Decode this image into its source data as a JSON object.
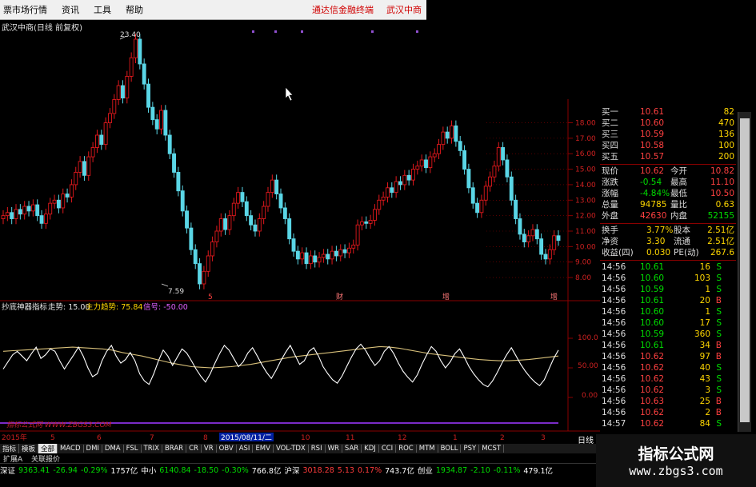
{
  "menu": {
    "items": [
      "票市场行情",
      "资讯",
      "工具",
      "帮助"
    ],
    "right_link": "通达信金融终端",
    "right_stock": "武汉中商"
  },
  "stock_title": "武汉中商(日线 前复权)",
  "price_axis": {
    "ticks": [
      "18.00",
      "17.00",
      "16.00",
      "15.00",
      "14.00",
      "13.00",
      "12.00",
      "11.00",
      "10.00",
      "9.00",
      "8.00"
    ]
  },
  "annotations": {
    "high": "23.40",
    "low": "7.59"
  },
  "event_markers": [
    "5",
    "财",
    "增",
    "增"
  ],
  "indicator": {
    "name": "抄底神器指标",
    "trend_label": "走势: 15.00",
    "main_label": "主力趋势: 75.84",
    "signal_label": "信号: -50.00",
    "axis_ticks": [
      "100.0",
      "50.00",
      "0.00"
    ],
    "chart_watermark": "指标公式网 WWW.ZBGS3.COM"
  },
  "time_axis": {
    "labels": [
      "2015年",
      "5",
      "6",
      "7",
      "8",
      "2015/08/11/二",
      "10",
      "11",
      "12",
      "1",
      "2",
      "3"
    ],
    "period": "日线"
  },
  "quote_panel": {
    "bids": [
      {
        "label": "买一",
        "price": "10.61",
        "vol": "82"
      },
      {
        "label": "买二",
        "price": "10.60",
        "vol": "470"
      },
      {
        "label": "买三",
        "price": "10.59",
        "vol": "136"
      },
      {
        "label": "买四",
        "price": "10.58",
        "vol": "100"
      },
      {
        "label": "买五",
        "price": "10.57",
        "vol": "200"
      }
    ],
    "stats": [
      {
        "l1": "现价",
        "v1": "10.62",
        "l2": "今开",
        "v2": "10.82"
      },
      {
        "l1": "涨跌",
        "v1": "-0.54",
        "l2": "最高",
        "v2": "11.10"
      },
      {
        "l1": "涨幅",
        "v1": "-4.84%",
        "l2": "最低",
        "v2": "10.50"
      },
      {
        "l1": "总量",
        "v1": "94785",
        "l2": "量比",
        "v2": "0.63"
      },
      {
        "l1": "外盘",
        "v1": "42630",
        "l2": "内盘",
        "v2": "52155"
      }
    ],
    "fundamentals": [
      {
        "l1": "换手",
        "v1": "3.77%",
        "l2": "股本",
        "v2": "2.51亿"
      },
      {
        "l1": "净资",
        "v1": "3.30",
        "l2": "流通",
        "v2": "2.51亿"
      },
      {
        "l1": "收益(四)",
        "v1": "0.030",
        "l2": "PE(动)",
        "v2": "267.6"
      }
    ],
    "ticks": [
      {
        "time": "14:56",
        "price": "10.61",
        "vol": "16",
        "bs": "S"
      },
      {
        "time": "14:56",
        "price": "10.60",
        "vol": "103",
        "bs": "S"
      },
      {
        "time": "14:56",
        "price": "10.59",
        "vol": "1",
        "bs": "S"
      },
      {
        "time": "14:56",
        "price": "10.61",
        "vol": "20",
        "bs": "B"
      },
      {
        "time": "14:56",
        "price": "10.60",
        "vol": "1",
        "bs": "S"
      },
      {
        "time": "14:56",
        "price": "10.60",
        "vol": "17",
        "bs": "S"
      },
      {
        "time": "14:56",
        "price": "10.59",
        "vol": "360",
        "bs": "S"
      },
      {
        "time": "14:56",
        "price": "10.61",
        "vol": "34",
        "bs": "B"
      },
      {
        "time": "14:56",
        "price": "10.62",
        "vol": "97",
        "bs": "B"
      },
      {
        "time": "14:56",
        "price": "10.62",
        "vol": "40",
        "bs": "S"
      },
      {
        "time": "14:56",
        "price": "10.62",
        "vol": "43",
        "bs": "S"
      },
      {
        "time": "14:56",
        "price": "10.62",
        "vol": "3",
        "bs": "S"
      },
      {
        "time": "14:56",
        "price": "10.63",
        "vol": "25",
        "bs": "B"
      },
      {
        "time": "14:56",
        "price": "10.62",
        "vol": "2",
        "bs": "B"
      },
      {
        "time": "14:57",
        "price": "10.62",
        "vol": "84",
        "bs": "S"
      }
    ]
  },
  "indicator_tabs": [
    "指标",
    "模板",
    "全部",
    "MACD",
    "DMI",
    "DMA",
    "FSL",
    "TRIX",
    "BRAR",
    "CR",
    "VR",
    "OBV",
    "ASI",
    "EMV",
    "VOL-TDX",
    "RSI",
    "WR",
    "SAR",
    "KDJ",
    "CCI",
    "ROC",
    "MTM",
    "BOLL",
    "PSY",
    "MCST"
  ],
  "row2_items": [
    "扩展A",
    "关联报价"
  ],
  "status": [
    {
      "name": "深证",
      "value": "9363.41",
      "chg": "-26.94",
      "pct": "-0.29%",
      "amt": "1757亿"
    },
    {
      "name": "中小",
      "value": "6140.84",
      "chg": "-18.50",
      "pct": "-0.30%",
      "amt": "766.8亿"
    },
    {
      "name": "沪深",
      "value": "3018.28",
      "chg": "5.13",
      "pct": "0.17%",
      "amt": "743.7亿"
    },
    {
      "name": "创业",
      "value": "1934.87",
      "chg": "-2.10",
      "pct": "-0.11%",
      "amt": "479.1亿"
    }
  ],
  "site_watermark": {
    "title": "指标公式网",
    "url": "www.zbgs3.com"
  },
  "colors": {
    "up": "#e0181c",
    "down": "#5ad6e6",
    "bg": "#000000",
    "grid": "#8a0000",
    "trend_line": "#d8c07a",
    "signal_line": "#ffffff",
    "baseline": "#7a2cc8"
  },
  "chart_data": {
    "type": "candlestick",
    "price_range": [
      7.59,
      23.4
    ],
    "close_series": [
      12.0,
      12.2,
      11.8,
      12.4,
      12.1,
      12.6,
      12.3,
      12.7,
      12.0,
      11.5,
      12.1,
      12.8,
      13.0,
      12.5,
      13.4,
      13.2,
      14.0,
      14.8,
      15.5,
      14.6,
      15.8,
      16.4,
      17.2,
      16.6,
      18.0,
      18.6,
      19.5,
      20.4,
      19.6,
      21.0,
      22.2,
      23.4,
      21.8,
      20.5,
      19.0,
      18.2,
      17.6,
      18.8,
      17.2,
      16.0,
      14.8,
      13.6,
      12.3,
      11.2,
      9.8,
      8.9,
      7.59,
      8.4,
      9.4,
      10.3,
      11.0,
      11.8,
      11.1,
      12.0,
      12.8,
      13.5,
      12.9,
      12.0,
      11.4,
      11.0,
      11.8,
      12.6,
      13.5,
      14.3,
      13.4,
      12.5,
      11.8,
      10.5,
      9.7,
      9.2,
      9.6,
      8.9,
      9.4,
      9.0,
      9.3,
      9.5,
      9.2,
      9.7,
      9.4,
      9.8,
      9.6,
      9.9,
      10.1,
      11.4,
      11.6,
      11.5,
      11.7,
      12.4,
      13.0,
      13.2,
      13.8,
      13.5,
      14.2,
      14.0,
      14.6,
      14.3,
      15.0,
      15.2,
      15.6,
      15.1,
      15.8,
      16.0,
      16.6,
      17.4,
      17.0,
      17.8,
      16.8,
      16.2,
      15.0,
      13.8,
      12.8,
      12.2,
      13.0,
      13.9,
      14.5,
      15.2,
      16.4,
      15.6,
      14.5,
      13.0,
      11.8,
      10.8,
      10.3,
      10.7,
      11.1,
      10.5,
      9.5,
      9.2,
      9.8,
      10.7,
      10.4
    ],
    "trend_series": [
      78,
      79,
      80,
      81,
      82,
      83,
      84,
      85,
      84,
      83,
      82,
      80,
      76,
      73,
      70,
      66,
      62,
      58,
      55,
      52,
      51,
      50,
      51,
      52,
      54,
      56,
      59,
      62,
      65,
      68,
      70,
      72,
      74,
      76,
      78,
      80,
      82,
      84,
      86,
      85,
      83,
      80,
      77,
      74,
      72,
      70,
      68,
      66,
      64,
      63,
      62,
      62,
      63,
      64,
      66,
      68,
      70
    ],
    "signal_series": [
      48,
      60,
      72,
      78,
      70,
      62,
      74,
      85,
      66,
      72,
      82,
      78,
      62,
      48,
      60,
      72,
      85,
      70,
      50,
      35,
      40,
      62,
      78,
      88,
      70,
      58,
      64,
      76,
      62,
      40,
      28,
      22,
      40,
      62,
      80,
      70,
      54,
      68,
      82,
      75,
      62,
      48,
      36,
      26,
      40,
      58,
      74,
      88,
      80,
      66,
      52,
      60,
      75,
      84,
      70,
      55,
      42,
      32,
      46,
      62,
      76,
      88,
      72,
      56,
      62,
      78,
      84,
      70,
      52,
      40,
      30,
      24,
      36,
      52,
      68,
      82,
      90,
      80,
      66,
      54,
      62,
      78,
      86,
      74,
      58,
      44,
      34,
      26,
      38,
      56,
      72,
      86,
      78,
      62,
      50,
      60,
      74,
      82,
      68,
      52,
      40,
      30,
      22,
      18,
      28,
      42,
      58,
      72,
      84,
      70,
      56,
      44,
      34,
      26,
      20,
      30,
      48,
      66,
      80
    ]
  }
}
